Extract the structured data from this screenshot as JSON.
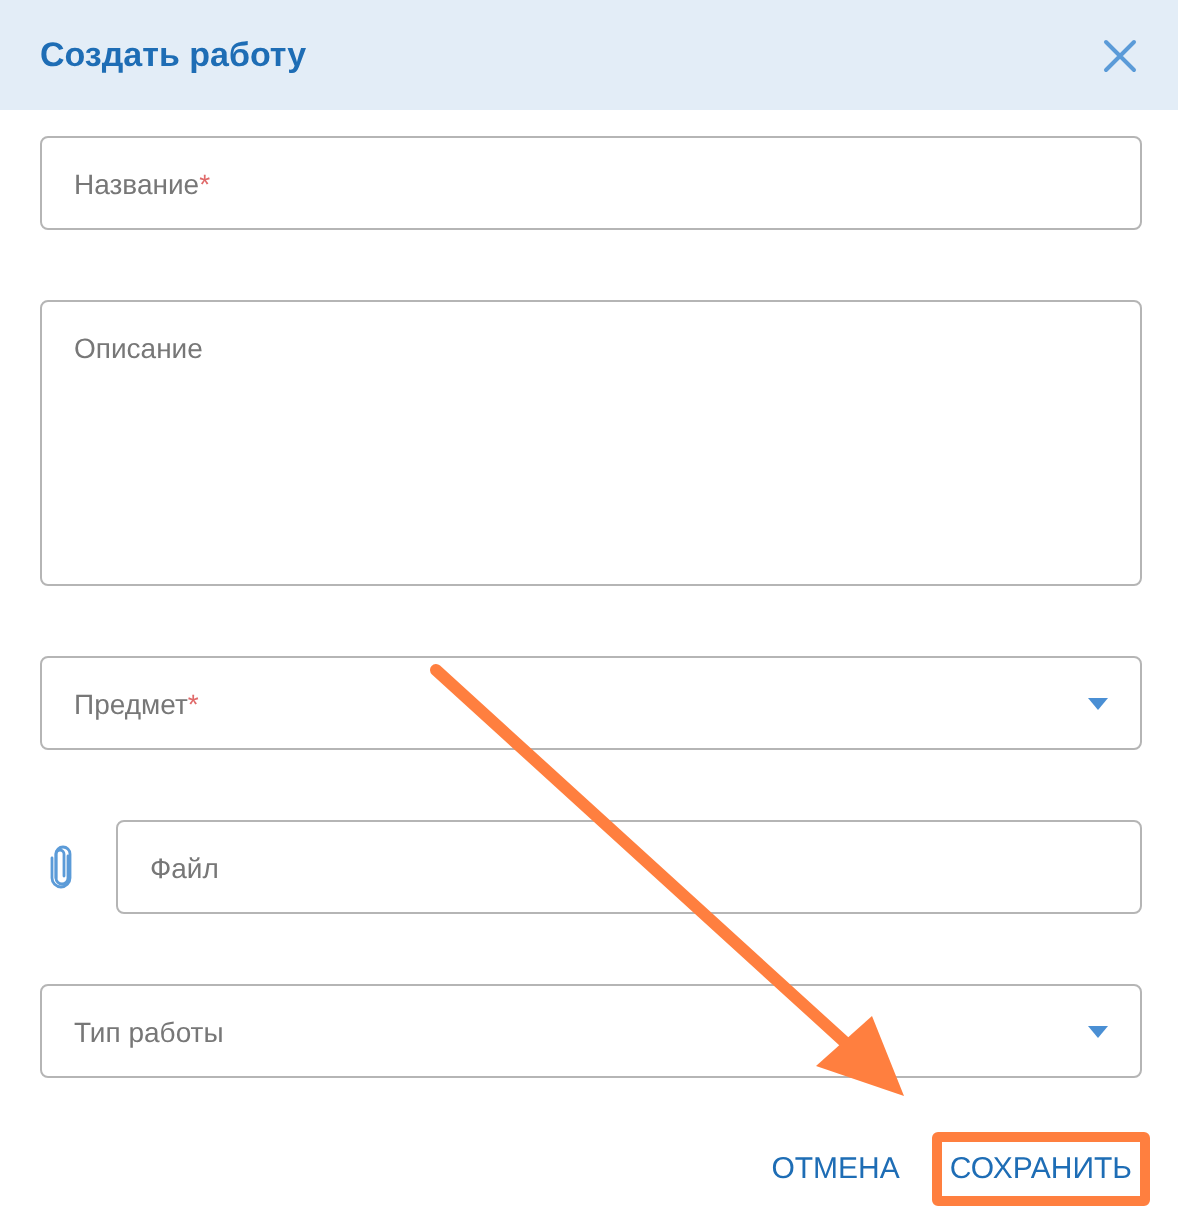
{
  "dialog": {
    "title": "Создать работу"
  },
  "fields": [
    {
      "kind": "text",
      "placeholder": "Название",
      "required_mark": "*"
    },
    {
      "kind": "textarea",
      "placeholder": "Описание"
    },
    {
      "kind": "select",
      "placeholder": "Предмет",
      "required_mark": "*"
    },
    {
      "kind": "file",
      "placeholder": "Файл"
    },
    {
      "kind": "select",
      "placeholder": "Тип работы"
    }
  ],
  "buttons": [
    {
      "label": "ОТМЕНА",
      "highlighted": false
    },
    {
      "label": "СОХРАНИТЬ",
      "highlighted": true
    }
  ]
}
